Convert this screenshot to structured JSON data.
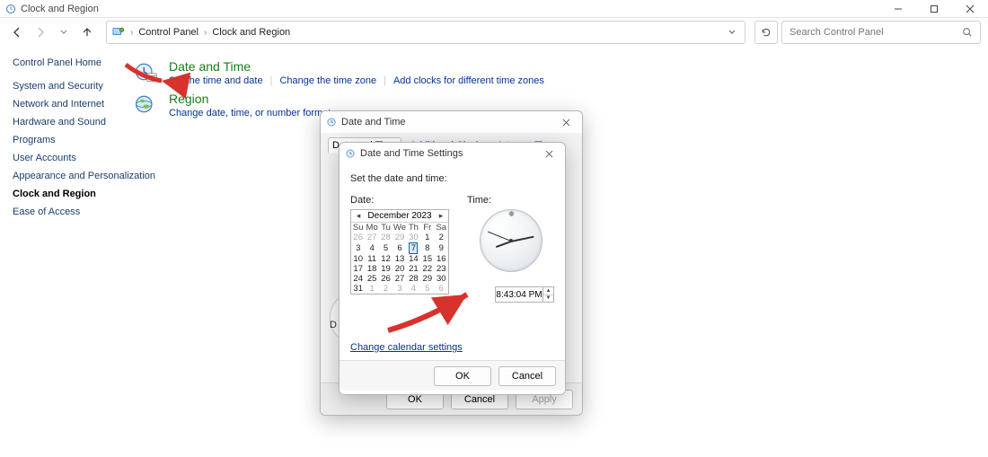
{
  "window": {
    "title": "Clock and Region",
    "minimize": "–",
    "maximize": "▢",
    "close": "✕"
  },
  "nav": {
    "crumb1": "Control Panel",
    "crumb2": "Clock and Region",
    "sep": "›"
  },
  "search": {
    "placeholder": "Search Control Panel"
  },
  "sidebar": {
    "home": "Control Panel Home",
    "items": [
      {
        "label": "System and Security"
      },
      {
        "label": "Network and Internet"
      },
      {
        "label": "Hardware and Sound"
      },
      {
        "label": "Programs"
      },
      {
        "label": "User Accounts"
      },
      {
        "label": "Appearance and Personalization"
      },
      {
        "label": "Clock and Region",
        "active": true
      },
      {
        "label": "Ease of Access"
      }
    ]
  },
  "content": {
    "items": [
      {
        "title": "Date and Time",
        "links": [
          "Set the time and date",
          "Change the time zone",
          "Add clocks for different time zones"
        ]
      },
      {
        "title": "Region",
        "links": [
          "Change date, time, or number formats"
        ]
      }
    ]
  },
  "dlg_parent": {
    "title": "Date and Time",
    "tabs": [
      "Date and Time",
      "Additional Clocks",
      "Internet Time"
    ],
    "d_prefix": "D",
    "ok": "OK",
    "cancel": "Cancel",
    "apply": "Apply"
  },
  "dlg_child": {
    "title": "Date and Time Settings",
    "instr": "Set the date and time:",
    "date_label": "Date:",
    "time_label": "Time:",
    "month": "December 2023",
    "dow": [
      "Su",
      "Mo",
      "Tu",
      "We",
      "Th",
      "Fr",
      "Sa"
    ],
    "weeks": [
      [
        {
          "n": "26",
          "g": true
        },
        {
          "n": "27",
          "g": true
        },
        {
          "n": "28",
          "g": true
        },
        {
          "n": "29",
          "g": true
        },
        {
          "n": "30",
          "g": true
        },
        {
          "n": "1"
        },
        {
          "n": "2"
        }
      ],
      [
        {
          "n": "3"
        },
        {
          "n": "4"
        },
        {
          "n": "5"
        },
        {
          "n": "6"
        },
        {
          "n": "7",
          "today": true
        },
        {
          "n": "8"
        },
        {
          "n": "9"
        }
      ],
      [
        {
          "n": "10"
        },
        {
          "n": "11"
        },
        {
          "n": "12"
        },
        {
          "n": "13"
        },
        {
          "n": "14"
        },
        {
          "n": "15"
        },
        {
          "n": "16"
        }
      ],
      [
        {
          "n": "17"
        },
        {
          "n": "18"
        },
        {
          "n": "19"
        },
        {
          "n": "20"
        },
        {
          "n": "21"
        },
        {
          "n": "22"
        },
        {
          "n": "23"
        }
      ],
      [
        {
          "n": "24"
        },
        {
          "n": "25"
        },
        {
          "n": "26"
        },
        {
          "n": "27"
        },
        {
          "n": "28"
        },
        {
          "n": "29"
        },
        {
          "n": "30"
        }
      ],
      [
        {
          "n": "31"
        },
        {
          "n": "1",
          "g": true
        },
        {
          "n": "2",
          "g": true
        },
        {
          "n": "3",
          "g": true
        },
        {
          "n": "4",
          "g": true
        },
        {
          "n": "5",
          "g": true
        },
        {
          "n": "6",
          "g": true
        }
      ]
    ],
    "time": "8:43:04 PM",
    "cal_link": "Change calendar settings",
    "ok": "OK",
    "cancel": "Cancel"
  },
  "clock_hands": {
    "hour_deg": 160,
    "minute_deg": -12,
    "second_deg": 202
  },
  "colors": {
    "link": "#003399",
    "heading": "#1a7c1a",
    "accent": "#0066cc",
    "arrow": "#d8322d"
  }
}
